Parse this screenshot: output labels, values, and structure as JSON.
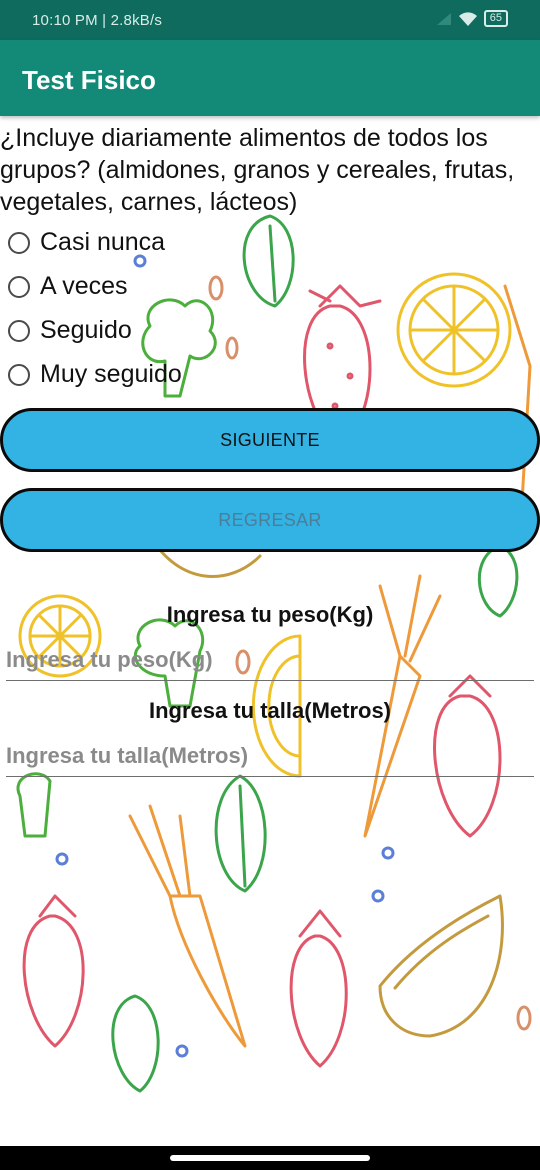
{
  "status_bar": {
    "time_speed": "10:10 PM | 2.8kB/s",
    "alarm_icon": "alarm-clock-icon",
    "dots": "••",
    "battery": "65"
  },
  "app_bar": {
    "title": "Test Fisico"
  },
  "question": {
    "text": "¿Incluye diariamente alimentos de todos los grupos? (almidones, granos y cereales, frutas, vegetales, carnes, lácteos)",
    "options": [
      "Casi nunca",
      "A veces",
      "Seguido",
      "Muy seguido"
    ]
  },
  "buttons": {
    "next": "SIGUIENTE",
    "back": "REGRESAR"
  },
  "weight": {
    "label": "Ingresa tu peso(Kg)",
    "placeholder": "Ingresa tu peso(Kg)"
  },
  "height": {
    "label": "Ingresa tu talla(Metros)",
    "placeholder": "Ingresa tu talla(Metros)"
  },
  "colors": {
    "status_bar": "#0f6b5e",
    "app_bar": "#138a78",
    "button_fill": "#33b2e4",
    "button_border": "#0a0a0a"
  }
}
